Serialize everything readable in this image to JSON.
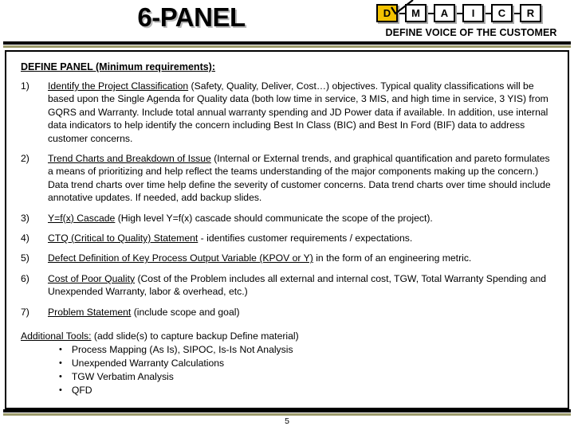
{
  "header": {
    "title": "6-PANEL",
    "roadmap": {
      "caption": "DEFINE VOICE OF THE CUSTOMER",
      "active_index": 0,
      "active_color": "#f2c200",
      "phases": [
        {
          "label": "D",
          "active": true
        },
        {
          "label": "M",
          "active": false
        },
        {
          "label": "A",
          "active": false
        },
        {
          "label": "I",
          "active": false
        },
        {
          "label": "C",
          "active": false
        },
        {
          "label": "R",
          "active": false
        }
      ]
    }
  },
  "content": {
    "panel_heading": "DEFINE PANEL (Minimum requirements):",
    "requirements": [
      {
        "number": "1)",
        "lead": "Identify the Project Classification",
        "rest": " (Safety, Quality, Deliver, Cost…) objectives. Typical quality classifications will be based upon the Single Agenda for Quality data (both low time in service, 3 MIS, and high time in service, 3 YIS) from GQRS and Warranty. Include total annual warranty spending and JD Power data if available. In addition, use internal data indicators to help identify the concern including Best In Class (BIC) and Best In Ford (BIF) data to address customer concerns."
      },
      {
        "number": "2)",
        "lead": "Trend Charts and Breakdown of Issue",
        "rest": " (Internal or External trends, and graphical quantification and pareto formulates a means of prioritizing and help reflect the teams understanding of the major components making up the concern.) Data trend charts over time help define the severity of customer concerns. Data trend charts over time should include annotative updates. If needed, add backup slides."
      },
      {
        "number": "3)",
        "lead": "Y=f(x) Cascade",
        "rest": " (High level Y=f(x) cascade should communicate the scope of the project)."
      },
      {
        "number": "4)",
        "lead": "CTQ (Critical to Quality) Statement",
        "rest": " - identifies customer requirements / expectations."
      },
      {
        "number": "5)",
        "lead": "Defect Definition of Key Process Output Variable (KPOV or Y)",
        "rest": " in the form of an engineering metric."
      },
      {
        "number": "6)",
        "lead": "Cost of Poor Quality",
        "rest": " (Cost of the Problem includes all external and internal cost, TGW, Total Warranty Spending and Unexpended Warranty, labor & overhead, etc.)"
      },
      {
        "number": "7)",
        "lead": "Problem Statement",
        "rest": " (include scope and goal)"
      }
    ],
    "additional_tools": {
      "label": "Additional Tools:",
      "note": " (add slide(s) to capture backup Define material)",
      "bullet_glyph": "•",
      "items": [
        "Process Mapping (As Is), SIPOC, Is-Is Not Analysis",
        "Unexpended Warranty Calculations",
        "TGW Verbatim Analysis",
        "QFD"
      ]
    }
  },
  "footer": {
    "page_number": "5"
  }
}
